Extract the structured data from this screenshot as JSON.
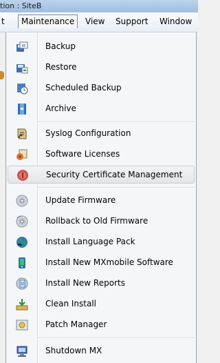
{
  "window": {
    "title_fragment": "tion : SiteB"
  },
  "menubar": {
    "items": [
      {
        "label": "t"
      },
      {
        "label": "Maintenance"
      },
      {
        "label": "View"
      },
      {
        "label": "Support"
      },
      {
        "label": "Window"
      }
    ]
  },
  "menu": {
    "items": [
      {
        "label": "Backup",
        "icon": "backup-icon"
      },
      {
        "label": "Restore",
        "icon": "restore-icon"
      },
      {
        "label": "Scheduled Backup",
        "icon": "scheduled-backup-icon"
      },
      {
        "label": "Archive",
        "icon": "archive-icon"
      },
      {
        "label": "Syslog Configuration",
        "icon": "syslog-icon"
      },
      {
        "label": "Software Licenses",
        "icon": "license-icon"
      },
      {
        "label": "Security Certificate Management",
        "icon": "certificate-icon"
      },
      {
        "label": "Update Firmware",
        "icon": "disc-icon"
      },
      {
        "label": "Rollback to Old Firmware",
        "icon": "disc-rollback-icon"
      },
      {
        "label": "Install Language Pack",
        "icon": "globe-icon"
      },
      {
        "label": "Install New MXmobile Software",
        "icon": "mobile-icon"
      },
      {
        "label": "Install New Reports",
        "icon": "reports-icon"
      },
      {
        "label": "Clean Install",
        "icon": "clean-install-icon"
      },
      {
        "label": "Patch Manager",
        "icon": "patch-icon"
      },
      {
        "label": "Shutdown MX",
        "icon": "shutdown-icon"
      }
    ],
    "highlighted": "Security Certificate Management"
  },
  "colors": {
    "menu_bg": "#f5f6f7",
    "highlight": "#e3e5e8",
    "border": "#97a3b3"
  }
}
